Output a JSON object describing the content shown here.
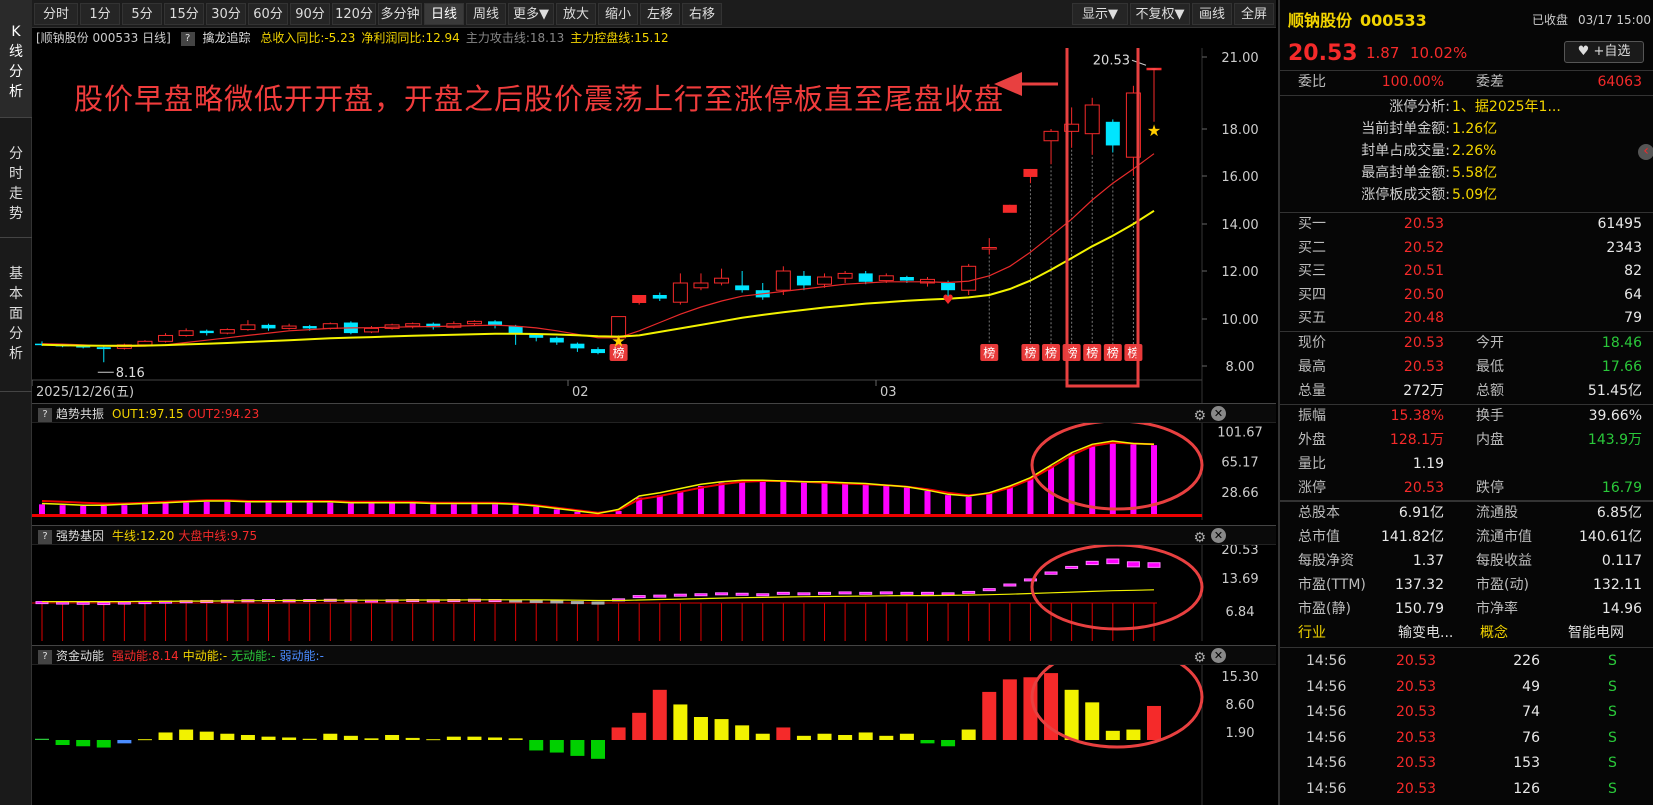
{
  "sidebar": {
    "tabs": [
      {
        "label": "K线分析",
        "chars": [
          "K",
          "线",
          "分",
          "析"
        ]
      },
      {
        "label": "分时走势",
        "chars": [
          "分",
          "时",
          "走",
          "势"
        ]
      },
      {
        "label": "基本面分析",
        "chars": [
          "基",
          "本",
          "面",
          "分",
          "析"
        ]
      }
    ]
  },
  "toolbar": {
    "buttons": [
      "分时",
      "1分",
      "5分",
      "15分",
      "30分",
      "60分",
      "90分",
      "120分",
      "多分钟",
      "日线",
      "周线",
      "更多▼",
      "放大",
      "缩小",
      "左移",
      "右移"
    ],
    "right_buttons": [
      "显示▼",
      "不复权▼",
      "画线",
      "全屏"
    ],
    "active": "日线"
  },
  "info": {
    "stock": "[顺钠股份 000533 日线]",
    "indicator": "擒龙追踪",
    "items": [
      {
        "text": "总收入同比:-5.23",
        "color": "#f2d400"
      },
      {
        "text": "净利润同比:12.94",
        "color": "#f2d400"
      },
      {
        "text": "主力攻击线:18.13",
        "color": "#888888"
      },
      {
        "text": "主力控盘线:15.12",
        "color": "#f2d400"
      }
    ]
  },
  "annotation": "股价早盘略微低开开盘，开盘之后股价震荡上行至涨停板直至尾盘收盘",
  "main_chart": {
    "y_ticks": [
      "21.00",
      "18.00",
      "16.00",
      "14.00",
      "12.00",
      "10.00",
      "8.00"
    ],
    "x_labels": [
      "2025/12/26(五)",
      "02",
      "03"
    ],
    "low_label": "8.16",
    "high_label": "20.53",
    "bang": "榜",
    "candles": [
      [
        8.95,
        8.9,
        9.05,
        8.85
      ],
      [
        8.9,
        8.85,
        8.95,
        8.8
      ],
      [
        8.85,
        8.8,
        8.9,
        8.75
      ],
      [
        8.8,
        8.72,
        8.85,
        8.16
      ],
      [
        8.75,
        8.9,
        8.95,
        8.7
      ],
      [
        8.9,
        9.05,
        9.1,
        8.85
      ],
      [
        9.05,
        9.3,
        9.4,
        9.0
      ],
      [
        9.3,
        9.5,
        9.6,
        9.25
      ],
      [
        9.5,
        9.4,
        9.55,
        9.3
      ],
      [
        9.4,
        9.55,
        9.6,
        9.35
      ],
      [
        9.55,
        9.75,
        9.95,
        9.5
      ],
      [
        9.75,
        9.6,
        9.8,
        9.5
      ],
      [
        9.6,
        9.7,
        9.8,
        9.55
      ],
      [
        9.7,
        9.6,
        9.75,
        9.5
      ],
      [
        9.6,
        9.8,
        9.85,
        9.55
      ],
      [
        9.85,
        9.4,
        9.9,
        9.35
      ],
      [
        9.45,
        9.6,
        9.7,
        9.4
      ],
      [
        9.6,
        9.75,
        9.8,
        9.55
      ],
      [
        9.7,
        9.8,
        9.85,
        9.6
      ],
      [
        9.8,
        9.65,
        9.85,
        9.55
      ],
      [
        9.65,
        9.8,
        9.9,
        9.6
      ],
      [
        9.8,
        9.9,
        9.95,
        9.7
      ],
      [
        9.9,
        9.75,
        9.95,
        9.6
      ],
      [
        9.7,
        9.4,
        9.75,
        8.9
      ],
      [
        9.35,
        9.2,
        9.4,
        9.05
      ],
      [
        9.2,
        9.0,
        9.25,
        8.9
      ],
      [
        8.95,
        8.75,
        9.0,
        8.6
      ],
      [
        8.72,
        8.55,
        8.8,
        8.5
      ],
      [
        9.2,
        10.1,
        10.1,
        9.0
      ],
      [
        11.0,
        11.0,
        11.0,
        10.6
      ],
      [
        11.0,
        10.85,
        11.1,
        10.75
      ],
      [
        10.7,
        11.5,
        11.9,
        10.6
      ],
      [
        11.3,
        11.5,
        11.9,
        11.2
      ],
      [
        11.5,
        11.7,
        12.1,
        11.4
      ],
      [
        11.4,
        11.2,
        12.0,
        11.1
      ],
      [
        11.2,
        10.9,
        11.5,
        10.8
      ],
      [
        11.2,
        12.0,
        12.2,
        11.0
      ],
      [
        11.8,
        11.4,
        12.0,
        11.2
      ],
      [
        11.45,
        11.75,
        11.9,
        11.3
      ],
      [
        11.7,
        11.9,
        12.0,
        11.5
      ],
      [
        11.9,
        11.55,
        12.0,
        11.45
      ],
      [
        11.6,
        11.8,
        11.9,
        11.5
      ],
      [
        11.75,
        11.6,
        11.8,
        11.5
      ],
      [
        11.5,
        11.65,
        11.75,
        11.35
      ],
      [
        11.5,
        11.2,
        11.6,
        10.85
      ],
      [
        11.2,
        12.2,
        12.3,
        11.0
      ],
      [
        13.0,
        13.0,
        13.4,
        12.7
      ],
      [
        14.8,
        14.8,
        14.8,
        14.7
      ],
      [
        16.3,
        16.3,
        16.3,
        15.7
      ],
      [
        17.5,
        17.9,
        18.0,
        16.5
      ],
      [
        17.9,
        18.2,
        18.9,
        17.2
      ],
      [
        17.8,
        19.0,
        19.3,
        16.9
      ],
      [
        18.3,
        17.3,
        18.4,
        17.0
      ],
      [
        16.8,
        19.5,
        19.8,
        16.0
      ],
      [
        20.53,
        20.53,
        20.53,
        18.3
      ]
    ],
    "ma_short": [
      8.95,
      8.93,
      8.9,
      8.85,
      8.83,
      8.85,
      8.9,
      9.0,
      9.1,
      9.2,
      9.3,
      9.4,
      9.5,
      9.55,
      9.6,
      9.62,
      9.63,
      9.65,
      9.67,
      9.68,
      9.7,
      9.72,
      9.74,
      9.7,
      9.62,
      9.5,
      9.35,
      9.2,
      9.2,
      9.5,
      9.85,
      10.2,
      10.5,
      10.75,
      10.95,
      11.05,
      11.15,
      11.25,
      11.35,
      11.45,
      11.5,
      11.55,
      11.55,
      11.55,
      11.52,
      11.58,
      11.8,
      12.2,
      12.8,
      13.5,
      14.2,
      15.0,
      15.7,
      16.3,
      16.95
    ],
    "ma_long": [
      8.9,
      8.88,
      8.87,
      8.86,
      8.86,
      8.87,
      8.89,
      8.92,
      8.95,
      8.98,
      9.02,
      9.06,
      9.1,
      9.14,
      9.18,
      9.21,
      9.23,
      9.26,
      9.29,
      9.31,
      9.33,
      9.35,
      9.37,
      9.37,
      9.36,
      9.34,
      9.31,
      9.27,
      9.25,
      9.3,
      9.45,
      9.6,
      9.75,
      9.9,
      10.05,
      10.17,
      10.28,
      10.38,
      10.48,
      10.56,
      10.64,
      10.7,
      10.76,
      10.81,
      10.84,
      10.9,
      11.0,
      11.25,
      11.6,
      12.05,
      12.55,
      13.05,
      13.5,
      14.0,
      14.55
    ],
    "bang_idx": [
      28,
      46,
      48,
      49,
      50,
      51,
      52,
      53
    ],
    "star_idx": [
      28,
      54
    ],
    "heart_idx": 44
  },
  "panels": [
    {
      "title": "趋势共振",
      "items": [
        {
          "text": "OUT1:97.15",
          "color": "#f2d400"
        },
        {
          "text": "OUT2:94.23",
          "color": "#f52a2a"
        }
      ],
      "y_ticks": [
        "101.67",
        "65.17",
        "28.66"
      ]
    },
    {
      "title": "强势基因",
      "items": [
        {
          "text": "牛线:12.20",
          "color": "#f2d400"
        },
        {
          "text": "大盘中线:9.75",
          "color": "#f52a2a"
        }
      ],
      "y_ticks": [
        "20.53",
        "13.69",
        "6.84"
      ]
    },
    {
      "title": "资金动能",
      "items": [
        {
          "text": "强动能:8.14",
          "color": "#f52a2a"
        },
        {
          "text": "中动能:-",
          "color": "#f2d400"
        },
        {
          "text": "无动能:-",
          "color": "#2ac83a"
        },
        {
          "text": "弱动能:-",
          "color": "#4a8cff"
        }
      ],
      "y_ticks": [
        "15.30",
        "8.60",
        "1.90"
      ]
    }
  ],
  "trend_bars": [
    14,
    13,
    12,
    12,
    13,
    14,
    15,
    16,
    17,
    17,
    16,
    16,
    16,
    16,
    16,
    15,
    15,
    15,
    15,
    14,
    14,
    14,
    14,
    13,
    11,
    8,
    5,
    2,
    6,
    22,
    25,
    30,
    36,
    40,
    42,
    42,
    41,
    40,
    40,
    39,
    38,
    36,
    34,
    30,
    25,
    23,
    27,
    35,
    45,
    60,
    75,
    85,
    88,
    86,
    85,
    90
  ],
  "trend_line1": [
    15,
    14,
    13,
    13,
    14,
    15,
    16,
    17,
    18,
    18,
    17,
    17,
    17,
    17,
    17,
    16,
    16,
    16,
    16,
    15,
    15,
    15,
    15,
    14,
    12,
    9,
    6,
    3,
    8,
    24,
    28,
    33,
    38,
    41,
    43,
    43,
    42,
    41,
    41,
    40,
    39,
    37,
    35,
    31,
    26,
    24,
    28,
    36,
    46,
    61,
    76,
    86,
    90,
    87,
    86,
    91
  ],
  "trend_line2": [
    18,
    17,
    16,
    15,
    15,
    16,
    17,
    18,
    19,
    19,
    18,
    18,
    18,
    18,
    18,
    17,
    17,
    17,
    17,
    16,
    16,
    16,
    16,
    15,
    13,
    10,
    7,
    4,
    7,
    20,
    24,
    29,
    34,
    38,
    41,
    42,
    42,
    41,
    40,
    39,
    38,
    37,
    35,
    32,
    28,
    25,
    27,
    34,
    44,
    58,
    73,
    84,
    88,
    87,
    86,
    90
  ],
  "gene_boxes": [
    [
      9.6,
      9.5
    ],
    [
      9.5,
      9.45
    ],
    [
      9.45,
      9.4
    ],
    [
      9.4,
      9.35
    ],
    [
      9.5,
      9.4
    ],
    [
      9.6,
      9.5
    ],
    [
      9.7,
      9.6
    ],
    [
      9.8,
      9.7
    ],
    [
      9.85,
      9.8
    ],
    [
      9.9,
      9.85
    ],
    [
      10.0,
      9.9
    ],
    [
      10.05,
      9.95
    ],
    [
      10.0,
      9.95
    ],
    [
      10.05,
      10.0
    ],
    [
      10.1,
      10.05
    ],
    [
      10.0,
      9.9
    ],
    [
      9.95,
      9.9
    ],
    [
      10.0,
      9.95
    ],
    [
      10.05,
      10.0
    ],
    [
      10.0,
      9.95
    ],
    [
      10.05,
      10.0
    ],
    [
      10.1,
      10.05
    ],
    [
      10.05,
      10.0
    ],
    [
      9.95,
      9.8
    ],
    [
      9.85,
      9.75
    ],
    [
      9.75,
      9.65
    ],
    [
      9.6,
      9.5
    ],
    [
      9.5,
      9.4
    ],
    [
      10.2,
      9.9
    ],
    [
      10.9,
      10.5
    ],
    [
      11.0,
      10.8
    ],
    [
      11.2,
      11.0
    ],
    [
      11.3,
      11.15
    ],
    [
      11.5,
      11.3
    ],
    [
      11.4,
      11.2
    ],
    [
      11.3,
      11.1
    ],
    [
      11.6,
      11.3
    ],
    [
      11.5,
      11.3
    ],
    [
      11.6,
      11.4
    ],
    [
      11.7,
      11.5
    ],
    [
      11.6,
      11.5
    ],
    [
      11.7,
      11.55
    ],
    [
      11.6,
      11.5
    ],
    [
      11.6,
      11.45
    ],
    [
      11.5,
      11.3
    ],
    [
      11.8,
      11.5
    ],
    [
      12.4,
      12.1
    ],
    [
      13.4,
      13.2
    ],
    [
      14.5,
      14.3
    ],
    [
      16.0,
      15.5
    ],
    [
      17.2,
      16.8
    ],
    [
      18.3,
      17.6
    ],
    [
      18.8,
      17.8
    ],
    [
      18.2,
      17.1
    ],
    [
      18.0,
      17.0
    ],
    [
      20.0,
      18.6
    ]
  ],
  "gene_line": [
    9.6,
    9.6,
    9.6,
    9.6,
    9.6,
    9.65,
    9.65,
    9.7,
    9.7,
    9.75,
    9.8,
    9.8,
    9.85,
    9.85,
    9.9,
    9.9,
    9.9,
    9.9,
    9.95,
    9.95,
    9.95,
    10.0,
    10.0,
    10.0,
    10.0,
    9.95,
    9.9,
    9.85,
    9.85,
    9.95,
    10.05,
    10.15,
    10.25,
    10.35,
    10.45,
    10.5,
    10.6,
    10.65,
    10.7,
    10.75,
    10.8,
    10.85,
    10.9,
    10.9,
    10.95,
    11.0,
    11.1,
    11.2,
    11.35,
    11.5,
    11.65,
    11.8,
    11.95,
    12.05,
    12.15,
    12.2
  ],
  "money_bars": [
    0.3,
    -1.2,
    -1.5,
    -1.8,
    -0.8,
    0.2,
    1.8,
    2.5,
    2.0,
    1.5,
    1.2,
    0.8,
    0.6,
    0.3,
    1.5,
    1.0,
    0.4,
    1.2,
    0.5,
    0.2,
    0.8,
    0.8,
    0.6,
    0.4,
    -2.5,
    -3.0,
    -3.8,
    -4.5,
    3.0,
    6.5,
    12.0,
    8.5,
    5.5,
    5.0,
    3.5,
    1.5,
    3.0,
    1.0,
    1.5,
    1.2,
    1.8,
    1.0,
    1.5,
    -0.8,
    -1.5,
    2.5,
    11.5,
    14.5,
    15.0,
    16.0,
    12.0,
    9.0,
    2.2,
    2.5,
    8.14
  ],
  "quote": {
    "name": "顺钠股份",
    "code": "000533",
    "status": "已收盘",
    "time": "03/17 15:00",
    "price": "20.53",
    "change": "1.87",
    "pct": "10.02%",
    "watch": "+自选",
    "weibi_l": "委比",
    "weibi": "100.00%",
    "weicha_l": "委差",
    "weicha": "64063",
    "limit": [
      {
        "k": "涨停分析:",
        "v": "1、据2025年1..."
      },
      {
        "k": "当前封单金额:",
        "v": "1.26亿"
      },
      {
        "k": "封单占成交量:",
        "v": "2.26%"
      },
      {
        "k": "最高封单金额:",
        "v": "5.58亿"
      },
      {
        "k": "涨停板成交额:",
        "v": "5.09亿"
      }
    ],
    "bids": [
      {
        "l": "买一",
        "p": "20.53",
        "v": "61495"
      },
      {
        "l": "买二",
        "p": "20.52",
        "v": "2343"
      },
      {
        "l": "买三",
        "p": "20.51",
        "v": "82"
      },
      {
        "l": "买四",
        "p": "20.50",
        "v": "64"
      },
      {
        "l": "买五",
        "p": "20.48",
        "v": "79"
      }
    ],
    "stats": [
      [
        {
          "l": "现价",
          "v": "20.53",
          "c": "red"
        },
        {
          "l": "今开",
          "v": "18.46",
          "c": "grn"
        }
      ],
      [
        {
          "l": "最高",
          "v": "20.53",
          "c": "red"
        },
        {
          "l": "最低",
          "v": "17.66",
          "c": "grn"
        }
      ],
      [
        {
          "l": "总量",
          "v": "272万",
          "c": "wht"
        },
        {
          "l": "总额",
          "v": "51.45亿",
          "c": "wht"
        }
      ],
      [
        {
          "l": "振幅",
          "v": "15.38%",
          "c": "red"
        },
        {
          "l": "换手",
          "v": "39.66%",
          "c": "wht"
        }
      ],
      [
        {
          "l": "外盘",
          "v": "128.1万",
          "c": "red"
        },
        {
          "l": "内盘",
          "v": "143.9万",
          "c": "grn"
        }
      ],
      [
        {
          "l": "量比",
          "v": "1.19",
          "c": "wht"
        },
        {
          "l": "",
          "v": "",
          "c": "wht"
        }
      ],
      [
        {
          "l": "涨停",
          "v": "20.53",
          "c": "red"
        },
        {
          "l": "跌停",
          "v": "16.79",
          "c": "grn"
        }
      ],
      [
        {
          "l": "总股本",
          "v": "6.91亿",
          "c": "wht"
        },
        {
          "l": "流通股",
          "v": "6.85亿",
          "c": "wht"
        }
      ],
      [
        {
          "l": "总市值",
          "v": "141.82亿",
          "c": "wht"
        },
        {
          "l": "流通市值",
          "v": "140.61亿",
          "c": "wht"
        }
      ],
      [
        {
          "l": "每股净资",
          "v": "1.37",
          "c": "wht"
        },
        {
          "l": "每股收益",
          "v": "0.117",
          "c": "wht"
        }
      ],
      [
        {
          "l": "市盈(TTM)",
          "v": "137.32",
          "c": "wht"
        },
        {
          "l": "市盈(动)",
          "v": "132.11",
          "c": "wht"
        }
      ],
      [
        {
          "l": "市盈(静)",
          "v": "150.79",
          "c": "wht"
        },
        {
          "l": "市净率",
          "v": "14.96",
          "c": "wht"
        }
      ]
    ],
    "industry_l": "行业",
    "industry": "输变电...",
    "concept_l": "概念",
    "concept": "智能电网",
    "ticks": [
      {
        "t": "14:56",
        "p": "20.53",
        "v": "226",
        "s": "S"
      },
      {
        "t": "14:56",
        "p": "20.53",
        "v": "49",
        "s": "S"
      },
      {
        "t": "14:56",
        "p": "20.53",
        "v": "74",
        "s": "S"
      },
      {
        "t": "14:56",
        "p": "20.53",
        "v": "76",
        "s": "S"
      },
      {
        "t": "14:56",
        "p": "20.53",
        "v": "153",
        "s": "S"
      },
      {
        "t": "14:56",
        "p": "20.53",
        "v": "126",
        "s": "S"
      }
    ]
  },
  "colors": {
    "up": "#f52a2a",
    "down": "#00e5ff",
    "ma1": "#e82a2a",
    "ma2": "#f2f200",
    "magenta": "#ff00ff",
    "yellow": "#f2f200",
    "green": "#00d000",
    "highlight": "#e84040"
  }
}
